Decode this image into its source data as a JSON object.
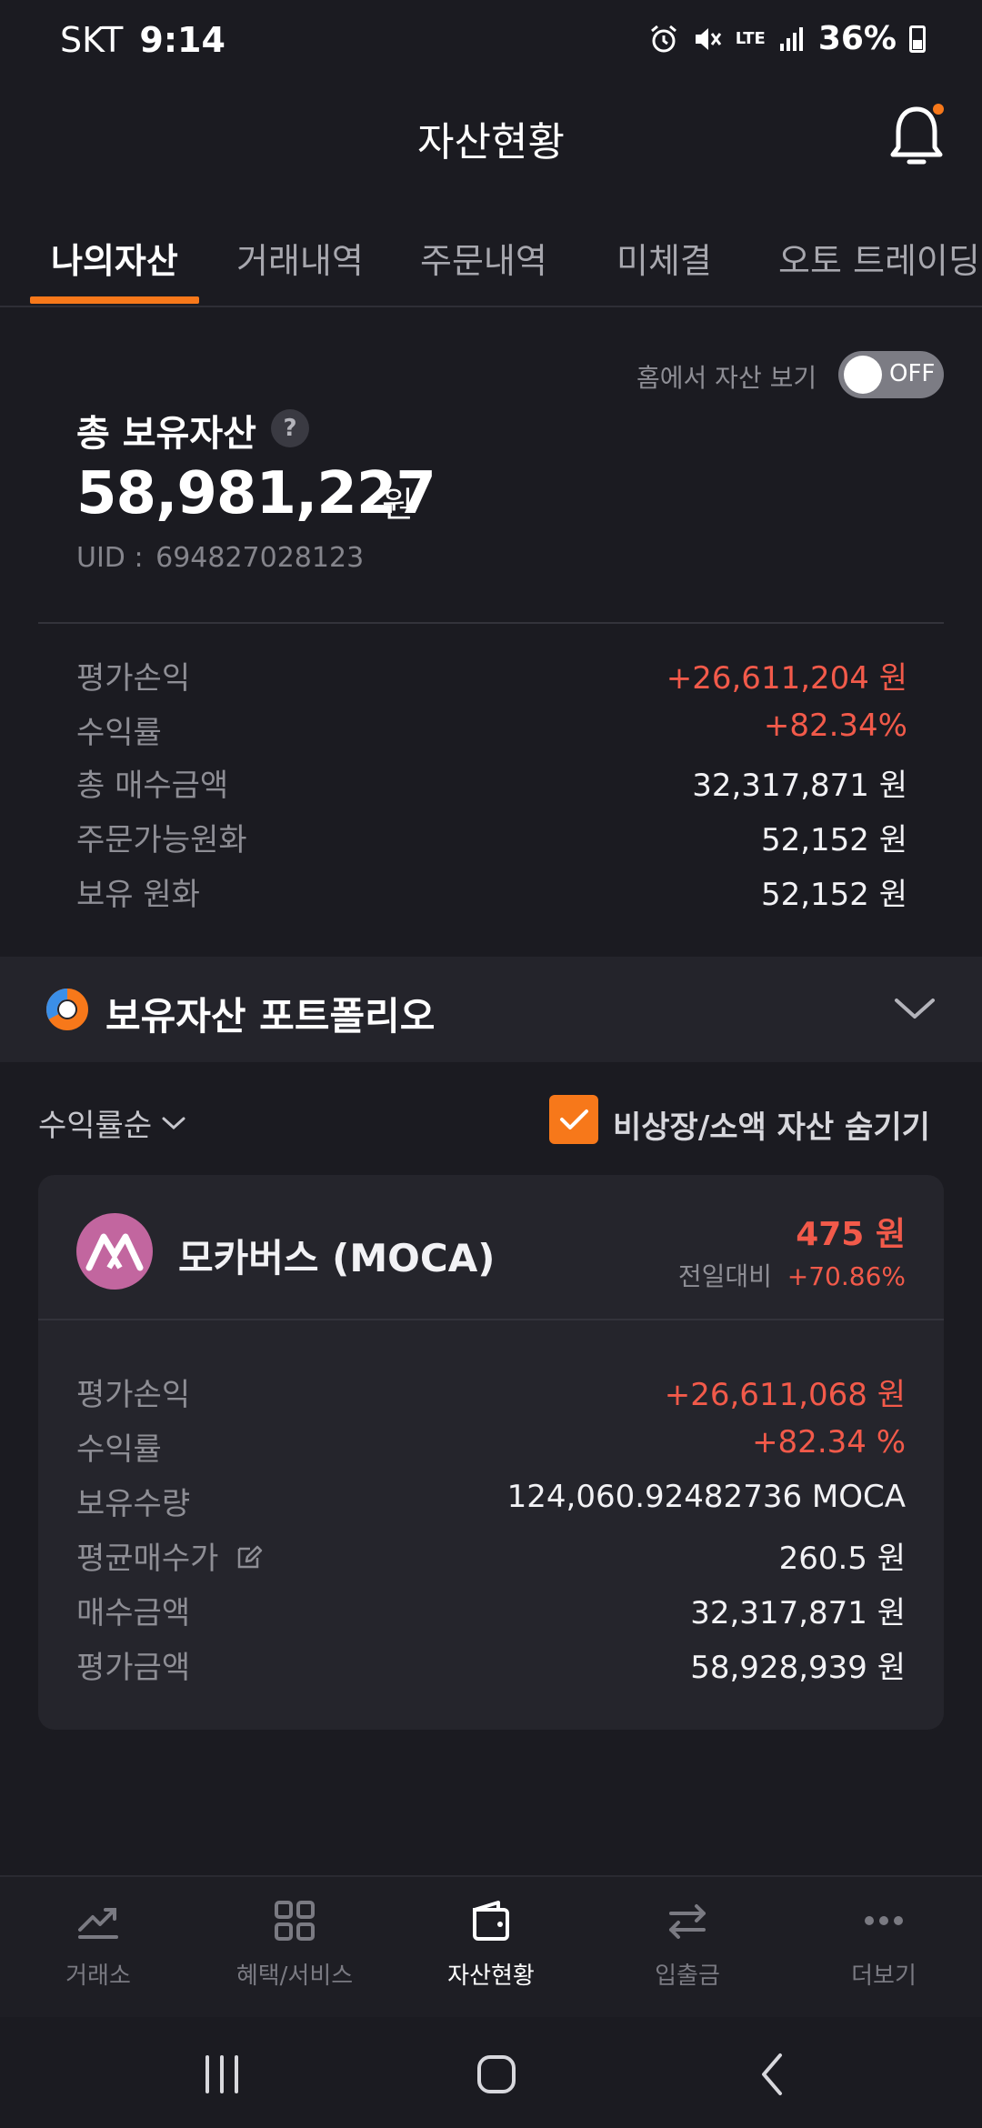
{
  "status": {
    "carrier": "SKT",
    "time": "9:14",
    "network": "LTE",
    "battery": "36%"
  },
  "header": {
    "title": "자산현황"
  },
  "tabs": [
    {
      "label": "나의자산",
      "active": true
    },
    {
      "label": "거래내역",
      "active": false
    },
    {
      "label": "주문내역",
      "active": false
    },
    {
      "label": "미체결",
      "active": false
    },
    {
      "label": "오토 트레이딩",
      "active": false
    }
  ],
  "summary": {
    "home_toggle_label": "홈에서 자산 보기",
    "home_toggle_state": "OFF",
    "total_label": "총 보유자산",
    "help_glyph": "?",
    "total_value": "58,981,227",
    "total_unit": "원",
    "uid_label": "UID :",
    "uid_value": "694827028123",
    "rows": [
      {
        "label": "평가손익",
        "value": "+26,611,204 원"
      },
      {
        "label": "수익률",
        "value": "+82.34%"
      },
      {
        "label": "총 매수금액",
        "value": "32,317,871 원"
      },
      {
        "label": "주문가능원화",
        "value": "52,152 원"
      },
      {
        "label": "보유 원화",
        "value": "52,152 원"
      }
    ]
  },
  "portfolio": {
    "title": "보유자산 포트폴리오"
  },
  "filters": {
    "sort_label": "수익률순",
    "hide_small_label": "비상장/소액 자산 숨기기",
    "hide_small_checked": true
  },
  "asset": {
    "name": "모카버스 (MOCA)",
    "price": "475 원",
    "change_label": "전일대비",
    "change_value": "+70.86%",
    "rows": [
      {
        "label": "평가손익",
        "value": "+26,611,068 원"
      },
      {
        "label": "수익률",
        "value": "+82.34 %"
      },
      {
        "label": "보유수량",
        "value": "124,060.92482736 MOCA"
      },
      {
        "label": "평균매수가",
        "value": "260.5 원"
      },
      {
        "label": "매수금액",
        "value": "32,317,871 원"
      },
      {
        "label": "평가금액",
        "value": "58,928,939 원"
      }
    ]
  },
  "bottom_nav": [
    {
      "label": "거래소",
      "icon": "chart-trend-icon",
      "active": false
    },
    {
      "label": "혜택/서비스",
      "icon": "grid-icon",
      "active": false
    },
    {
      "label": "자산현황",
      "icon": "wallet-icon",
      "active": true
    },
    {
      "label": "입출금",
      "icon": "transfer-icon",
      "active": false
    },
    {
      "label": "더보기",
      "icon": "more-icon",
      "active": false
    }
  ],
  "colors": {
    "background": "#1b1b21",
    "accent": "#f7781a",
    "positive": "#f25a4a",
    "coin_logo": "#c2669f"
  }
}
